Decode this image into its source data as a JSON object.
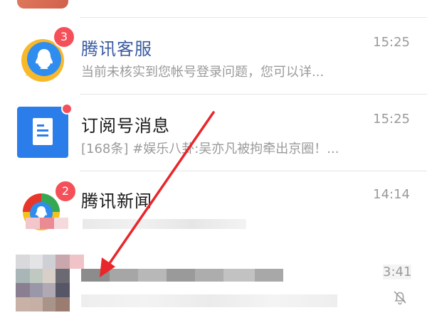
{
  "conversations": [
    {
      "title": "腾讯客服",
      "preview": "当前未核实到您帐号登录问题，您可以详...",
      "time": "15:25",
      "badge": "3",
      "avatar_icon": "qq-penguin-chat-icon"
    },
    {
      "title": "订阅号消息",
      "preview": "[168条] #娱乐八卦:吴亦凡被拘牵出京圈！...",
      "time": "15:25",
      "badge": "",
      "avatar_icon": "document-icon"
    },
    {
      "title": "腾讯新闻",
      "preview": "",
      "time": "14:14",
      "badge": "2",
      "avatar_icon": "tencent-news-icon"
    },
    {
      "title": "",
      "preview": "",
      "time": "3:41",
      "badge": "",
      "avatar_icon": "blurred-avatar",
      "status_icon": "muted-bell-icon"
    }
  ],
  "annotation": {
    "type": "arrow",
    "color": "#e8262b"
  },
  "colors": {
    "badge": "#f5505a",
    "title_blue": "#3a5aa0",
    "subscription_avatar": "#2b7de9"
  }
}
